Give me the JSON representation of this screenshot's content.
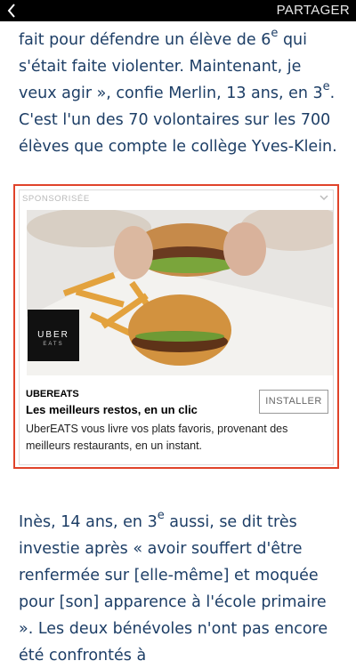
{
  "topbar": {
    "share_label": "PARTAGER"
  },
  "article": {
    "p1_a": "fait pour défendre un élève de 6",
    "p1_sup1": "e",
    "p1_b": " qui s'était faite violenter. Maintenant, je veux agir », confie Merlin, 13 ans, en 3",
    "p1_sup2": "e",
    "p1_c": ". C'est l'un des 70 volontaires sur les 700 élèves que compte le collège Yves-Klein.",
    "p2_a": "Inès, 14 ans, en 3",
    "p2_sup1": "e",
    "p2_b": " aussi, se dit très investie après « avoir souffert d'être renfermée sur [elle-même] et moquée pour [son] apparence à l'école primaire ». Les deux bénévoles n'ont pas encore été confrontés à"
  },
  "ad": {
    "sponsor_label": "SPONSORISÉE",
    "logo_line1": "UBER",
    "logo_line2": "EATS",
    "brand": "UBEREATS",
    "headline": "Les meilleurs restos, en un clic",
    "body": "UberEATS vous livre vos plats favoris, provenant des meilleurs restaurants, en un instant.",
    "install_label": "INSTALLER"
  },
  "colors": {
    "topbar": "#000000",
    "text": "#1d3e66",
    "ad_border": "#e0432a"
  },
  "icons": {
    "back": "chevron-left-icon",
    "ad_menu": "chevron-down-icon"
  }
}
